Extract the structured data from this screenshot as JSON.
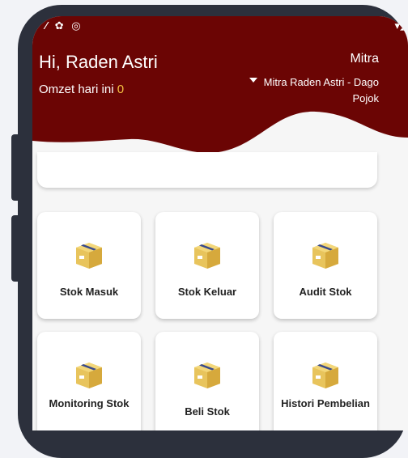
{
  "status_bar": {
    "left_icons": "⁄ ✿ ◎",
    "right_icons": "▾◢"
  },
  "header": {
    "greeting": "Hi, Raden Astri",
    "omzet_label": "Omzet hari ini",
    "omzet_value": "0",
    "role": "Mitra",
    "store_name": "Mitra Raden Astri - Dago Pojok"
  },
  "colors": {
    "brand": "#6b0504",
    "accent": "#f5c242"
  },
  "menu": [
    {
      "label": "Stok Masuk",
      "icon": "package-icon"
    },
    {
      "label": "Stok Keluar",
      "icon": "package-icon"
    },
    {
      "label": "Audit Stok",
      "icon": "package-icon"
    },
    {
      "label": "Monitoring Stok",
      "icon": "package-icon"
    },
    {
      "label": "Beli Stok",
      "icon": "package-icon"
    },
    {
      "label": "Histori Pembelian",
      "icon": "package-icon"
    }
  ]
}
